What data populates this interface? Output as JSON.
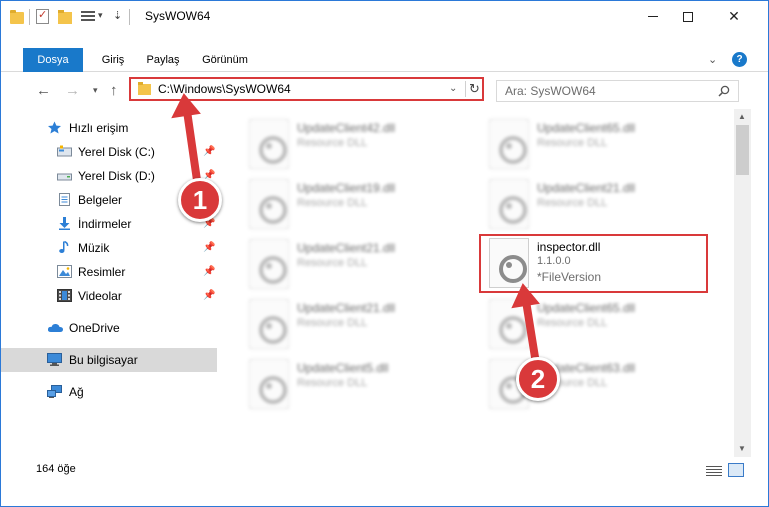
{
  "window": {
    "title": "SysWOW64"
  },
  "ribbon": {
    "tabs": [
      "Dosya",
      "Giriş",
      "Paylaş",
      "Görünüm"
    ],
    "help": "?"
  },
  "address": {
    "path": "C:\\Windows\\SysWOW64"
  },
  "search": {
    "placeholder": "Ara: SysWOW64"
  },
  "nav": {
    "quick_access": "Hızlı erişim",
    "items": [
      "Yerel Disk (C:)",
      "Yerel Disk (D:)",
      "Belgeler",
      "İndirmeler",
      "Müzik",
      "Resimler",
      "Videolar"
    ],
    "onedrive": "OneDrive",
    "this_pc": "Bu bilgisayar",
    "network": "Ağ"
  },
  "files": {
    "left_column": [
      {
        "name": "UpdateClient42.dll",
        "desc": "Resource DLL"
      },
      {
        "name": "UpdateClient19.dll",
        "desc": "Resource DLL"
      },
      {
        "name": "UpdateClient21.dll",
        "desc": "Resource DLL"
      },
      {
        "name": "UpdateClient21.dll",
        "desc": "Resource DLL"
      },
      {
        "name": "UpdateClient5.dll",
        "desc": "Resource DLL"
      }
    ],
    "right_column": [
      {
        "name": "UpdateClient65.dll",
        "desc": "Resource DLL"
      },
      {
        "name": "UpdateClient21.dll",
        "desc": "Resource DLL"
      },
      {
        "name": "UpdateClient65.dll",
        "desc": "Resource DLL"
      },
      {
        "name": "UpdateClient63.dll",
        "desc": "Resource DLL"
      }
    ],
    "focus": {
      "name": "inspector.dll",
      "version": "1.1.0.0",
      "label": "*FileVersion"
    }
  },
  "status": {
    "count": "164 öğe"
  },
  "annotations": {
    "step1": "1",
    "step2": "2",
    "color": "#d9393a"
  }
}
